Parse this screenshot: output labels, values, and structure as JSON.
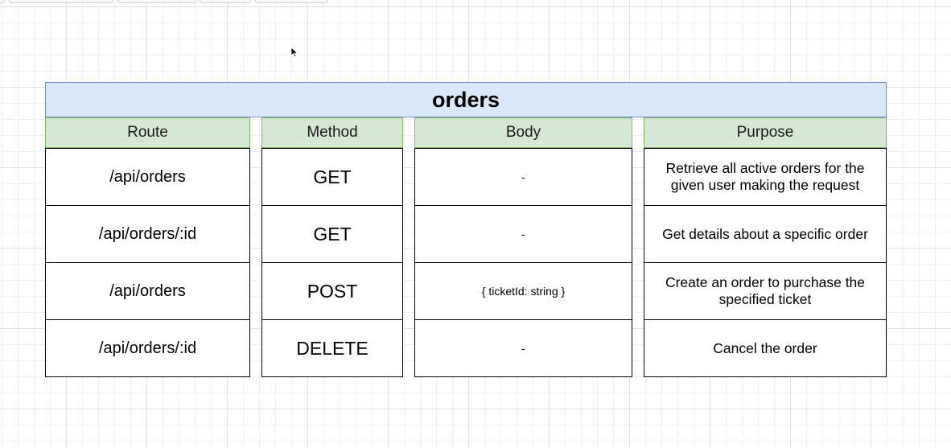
{
  "table": {
    "title": "orders",
    "headers": {
      "route": "Route",
      "method": "Method",
      "body": "Body",
      "purpose": "Purpose"
    },
    "rows": [
      {
        "route": "/api/orders",
        "method": "GET",
        "body": "-",
        "purpose": "Retrieve all active orders for the given user making the request"
      },
      {
        "route": "/api/orders/:id",
        "method": "GET",
        "body": "-",
        "purpose": "Get details about a specific order"
      },
      {
        "route": "/api/orders",
        "method": "POST",
        "body": "{ ticketId: string }",
        "purpose": "Create an order to purchase the specified ticket"
      },
      {
        "route": "/api/orders/:id",
        "method": "DELETE",
        "body": "-",
        "purpose": "Cancel the order"
      }
    ]
  },
  "colors": {
    "title_fill": "#dae8fc",
    "title_stroke": "#6c8ebf",
    "header_fill": "#d5e8d4",
    "header_stroke": "#82b366",
    "cell_stroke": "#000000"
  },
  "icons": {
    "cursor": "mouse-pointer-icon"
  }
}
